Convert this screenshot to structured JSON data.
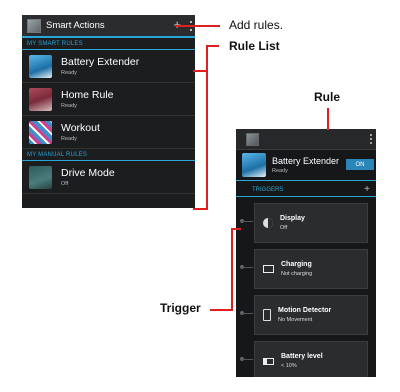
{
  "left_screen": {
    "title": "Smart Actions",
    "add_glyph": "+",
    "sections": [
      {
        "header": "MY SMART RULES",
        "rules": [
          {
            "name": "Battery Extender",
            "status": "Ready",
            "thumb": "battery-thumb"
          },
          {
            "name": "Home Rule",
            "status": "Ready",
            "thumb": "home-thumb"
          },
          {
            "name": "Workout",
            "status": "Ready",
            "thumb": "workout-thumb"
          }
        ]
      },
      {
        "header": "MY MANUAL RULES",
        "rules": [
          {
            "name": "Drive Mode",
            "status": "Off",
            "thumb": "drive-thumb"
          }
        ]
      }
    ]
  },
  "right_screen": {
    "rule": {
      "name": "Battery Extender",
      "status": "Ready",
      "toggle": "ON"
    },
    "triggers_header": "TRIGGERS",
    "add_glyph": "+",
    "triggers": [
      {
        "name": "Display",
        "status": "Off",
        "icon": "display-icon"
      },
      {
        "name": "Charging",
        "status": "Not charging",
        "icon": "charging-icon"
      },
      {
        "name": "Motion Detector",
        "status": "No Movement",
        "icon": "motion-icon"
      },
      {
        "name": "Battery level",
        "status": "< 10%",
        "icon": "battery-icon"
      }
    ]
  },
  "callouts": {
    "add_rules": "Add rules.",
    "rule_list": "Rule List",
    "rule": "Rule",
    "trigger": "Trigger"
  },
  "colors": {
    "accent": "#2aa6d8",
    "callout_line": "#e02020",
    "screen_bg": "#1b1d1f"
  }
}
